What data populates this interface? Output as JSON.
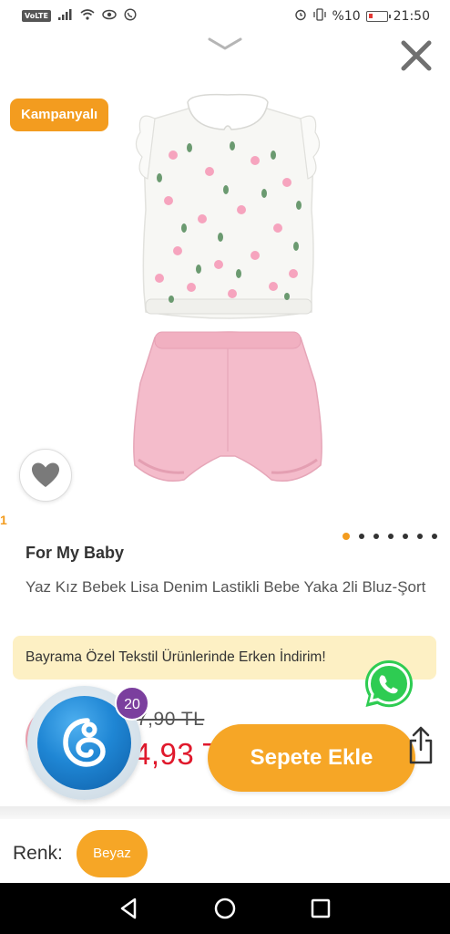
{
  "status_bar": {
    "network_label": "VoLTE",
    "battery_text": "%10",
    "time": "21:50"
  },
  "product": {
    "campaign_badge": "Kampanyalı",
    "brand": "For My Baby",
    "title": "Yaz Kız Bebek Lisa Denim Lastikli Bebe Yaka 2li Bluz-Şort",
    "image_pages": 7,
    "active_image_index": 0
  },
  "promo": {
    "text": "Bayrama Özel Tekstil Ürünlerinde Erken İndirim!"
  },
  "price": {
    "old": "7,90 TL",
    "new": "4,93 T",
    "floating_count": "20"
  },
  "actions": {
    "add_to_cart": "Sepete Ekle"
  },
  "variants": {
    "color_label": "Renk:",
    "selected_color": "Beyaz"
  },
  "colors": {
    "accent": "#f6a626",
    "badge": "#f39c1f",
    "price_red": "#e0192c",
    "promo_bg": "#fdf0c4",
    "counter_purple": "#7b3f9e"
  },
  "icons": {
    "collapse": "chevron-down-icon",
    "close": "close-icon",
    "favorite": "heart-icon",
    "whatsapp": "whatsapp-icon",
    "share": "share-icon",
    "nav_back": "back-triangle-icon",
    "nav_home": "home-circle-icon",
    "nav_recent": "recent-square-icon"
  }
}
